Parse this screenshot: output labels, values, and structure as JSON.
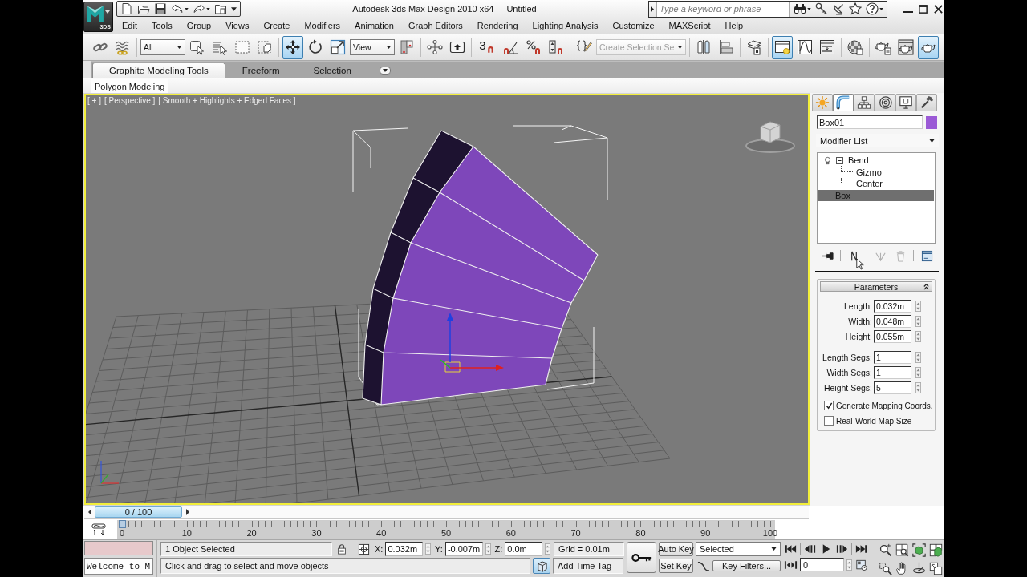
{
  "window": {
    "app_label": "3DS",
    "title": "Autodesk 3ds Max Design 2010 x64",
    "document": "Untitled"
  },
  "search": {
    "placeholder": "Type a keyword or phrase"
  },
  "menu": [
    "Edit",
    "Tools",
    "Group",
    "Views",
    "Create",
    "Modifiers",
    "Animation",
    "Graph Editors",
    "Rendering",
    "Lighting Analysis",
    "Customize",
    "MAXScript",
    "Help"
  ],
  "main_toolbar": [
    [
      {
        "kind": "link",
        "selected": false
      },
      {
        "kind": "bind",
        "selected": false
      }
    ],
    [
      {
        "kind": "dropdown",
        "value": "All",
        "disabled": false
      },
      {
        "kind": "select",
        "selected": false
      },
      {
        "kind": "select-by-name",
        "selected": false
      },
      {
        "kind": "region",
        "selected": false
      },
      {
        "kind": "window-crossing",
        "selected": false
      }
    ],
    [
      {
        "kind": "move",
        "selected": true
      },
      {
        "kind": "rotate",
        "selected": false
      },
      {
        "kind": "scale",
        "selected": false
      },
      {
        "kind": "dropdown",
        "value": "View",
        "disabled": false
      },
      {
        "kind": "pivot",
        "selected": false
      }
    ],
    [
      {
        "kind": "manipulate",
        "selected": false
      },
      {
        "kind": "keyboard-override",
        "selected": false
      }
    ],
    [
      {
        "kind": "snap",
        "label": "3",
        "selected": false
      },
      {
        "kind": "angle-snap",
        "selected": false
      },
      {
        "kind": "percent-snap",
        "selected": false
      },
      {
        "kind": "spinner-snap",
        "selected": false
      }
    ],
    [
      {
        "kind": "named-sets",
        "selected": false
      },
      {
        "kind": "dropdown",
        "value": "Create Selection Se",
        "disabled": true
      }
    ],
    [
      {
        "kind": "mirror",
        "selected": false
      },
      {
        "kind": "align",
        "selected": false
      }
    ],
    [
      {
        "kind": "layers",
        "selected": false
      }
    ],
    [
      {
        "kind": "ribbon",
        "selected": true
      },
      {
        "kind": "curve-editor",
        "selected": false
      },
      {
        "kind": "schematic",
        "selected": false
      }
    ],
    [
      {
        "kind": "material-editor",
        "selected": false
      }
    ],
    [
      {
        "kind": "render-setup",
        "selected": false
      },
      {
        "kind": "rendered-frame",
        "selected": false
      },
      {
        "kind": "quick-render",
        "selected": true
      }
    ]
  ],
  "ribbon": {
    "tabs": [
      {
        "label": "Graphite Modeling Tools",
        "selected": true
      },
      {
        "label": "Freeform",
        "selected": false
      },
      {
        "label": "Selection",
        "selected": false
      }
    ],
    "panel": "Polygon Modeling"
  },
  "viewport": {
    "active": true,
    "labels": [
      "[ + ]",
      "[ Perspective ]",
      "[ Smooth + Highlights + Edged Faces ]"
    ]
  },
  "command_panel": {
    "tabs": [
      {
        "kind": "create",
        "selected": false
      },
      {
        "kind": "modify",
        "selected": true
      },
      {
        "kind": "hierarchy",
        "selected": false
      },
      {
        "kind": "motion",
        "selected": false
      },
      {
        "kind": "display",
        "selected": false
      },
      {
        "kind": "utilities",
        "selected": false
      }
    ],
    "object": {
      "name": "Box01",
      "color": "#9b5ad6"
    },
    "modifier_list": "Modifier List",
    "stack": [
      {
        "label": "Bend",
        "expanded": true,
        "selected": false,
        "children": [
          {
            "label": "Gizmo",
            "selected": false
          },
          {
            "label": "Center",
            "selected": false
          }
        ]
      },
      {
        "label": "Box",
        "selected": true
      }
    ],
    "stack_tools": [
      {
        "kind": "pin",
        "disabled": false
      },
      {
        "kind": "show-end-result",
        "disabled": false
      },
      {
        "kind": "make-unique",
        "disabled": true
      },
      {
        "kind": "remove",
        "disabled": true
      },
      {
        "kind": "configure",
        "disabled": false
      }
    ],
    "rollout": {
      "title": "Parameters",
      "expanded": true,
      "groups": [
        [
          {
            "label": "Length:",
            "value": "0.032m"
          },
          {
            "label": "Width:",
            "value": "0.048m"
          },
          {
            "label": "Height:",
            "value": "0.055m"
          }
        ],
        [
          {
            "label": "Length Segs:",
            "value": "1"
          },
          {
            "label": "Width Segs:",
            "value": "1"
          },
          {
            "label": "Height Segs:",
            "value": "5"
          }
        ]
      ],
      "options": [
        {
          "label": "Generate Mapping Coords.",
          "checked": true
        },
        {
          "label": "Real-World Map Size",
          "checked": false
        }
      ]
    }
  },
  "timeline": {
    "label": "0 / 100",
    "level": 0,
    "ticks": [
      "0",
      "10",
      "20",
      "30",
      "40",
      "50",
      "60",
      "70",
      "80",
      "90",
      "100"
    ]
  },
  "status": {
    "listener": "Welcome to M",
    "selection": "1 Object Selected",
    "prompt": "Click and drag to select and move objects",
    "coords": [
      {
        "axis": "X:",
        "value": "0.032m"
      },
      {
        "axis": "Y:",
        "value": "-0.007m"
      },
      {
        "axis": "Z:",
        "value": "0.0m"
      }
    ],
    "grid": "Grid = 0.01m",
    "time_tag": "Add Time Tag"
  },
  "animation": {
    "auto_key": "Auto Key",
    "set_key": "Set Key",
    "key_mode": "Selected",
    "key_filters": "Key Filters...",
    "frame": "0"
  }
}
